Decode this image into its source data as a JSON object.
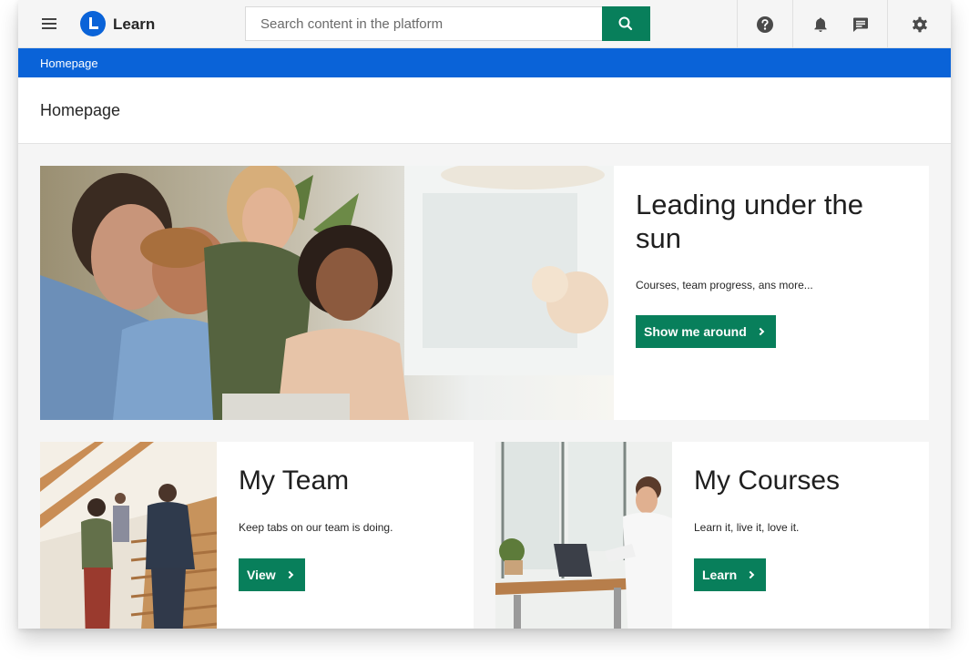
{
  "app": {
    "brand": "Learn",
    "colors": {
      "primary": "#0a63d8",
      "accent": "#087f5b"
    }
  },
  "search": {
    "placeholder": "Search content in the platform",
    "value": ""
  },
  "topbar": {
    "icons": [
      "menu-icon",
      "help-icon",
      "bell-icon",
      "chat-icon",
      "gear-icon"
    ]
  },
  "breadcrumb": {
    "items": [
      "Homepage"
    ]
  },
  "page": {
    "title": "Homepage"
  },
  "hero": {
    "title": "Leading under the sun",
    "description": "Courses, team progress, ans more...",
    "button_label": "Show me around"
  },
  "cards": [
    {
      "title": "My Team",
      "description": "Keep tabs on our team is doing.",
      "button_label": "View"
    },
    {
      "title": "My Courses",
      "description": "Learn it, live it, love it.",
      "button_label": "Learn"
    }
  ]
}
